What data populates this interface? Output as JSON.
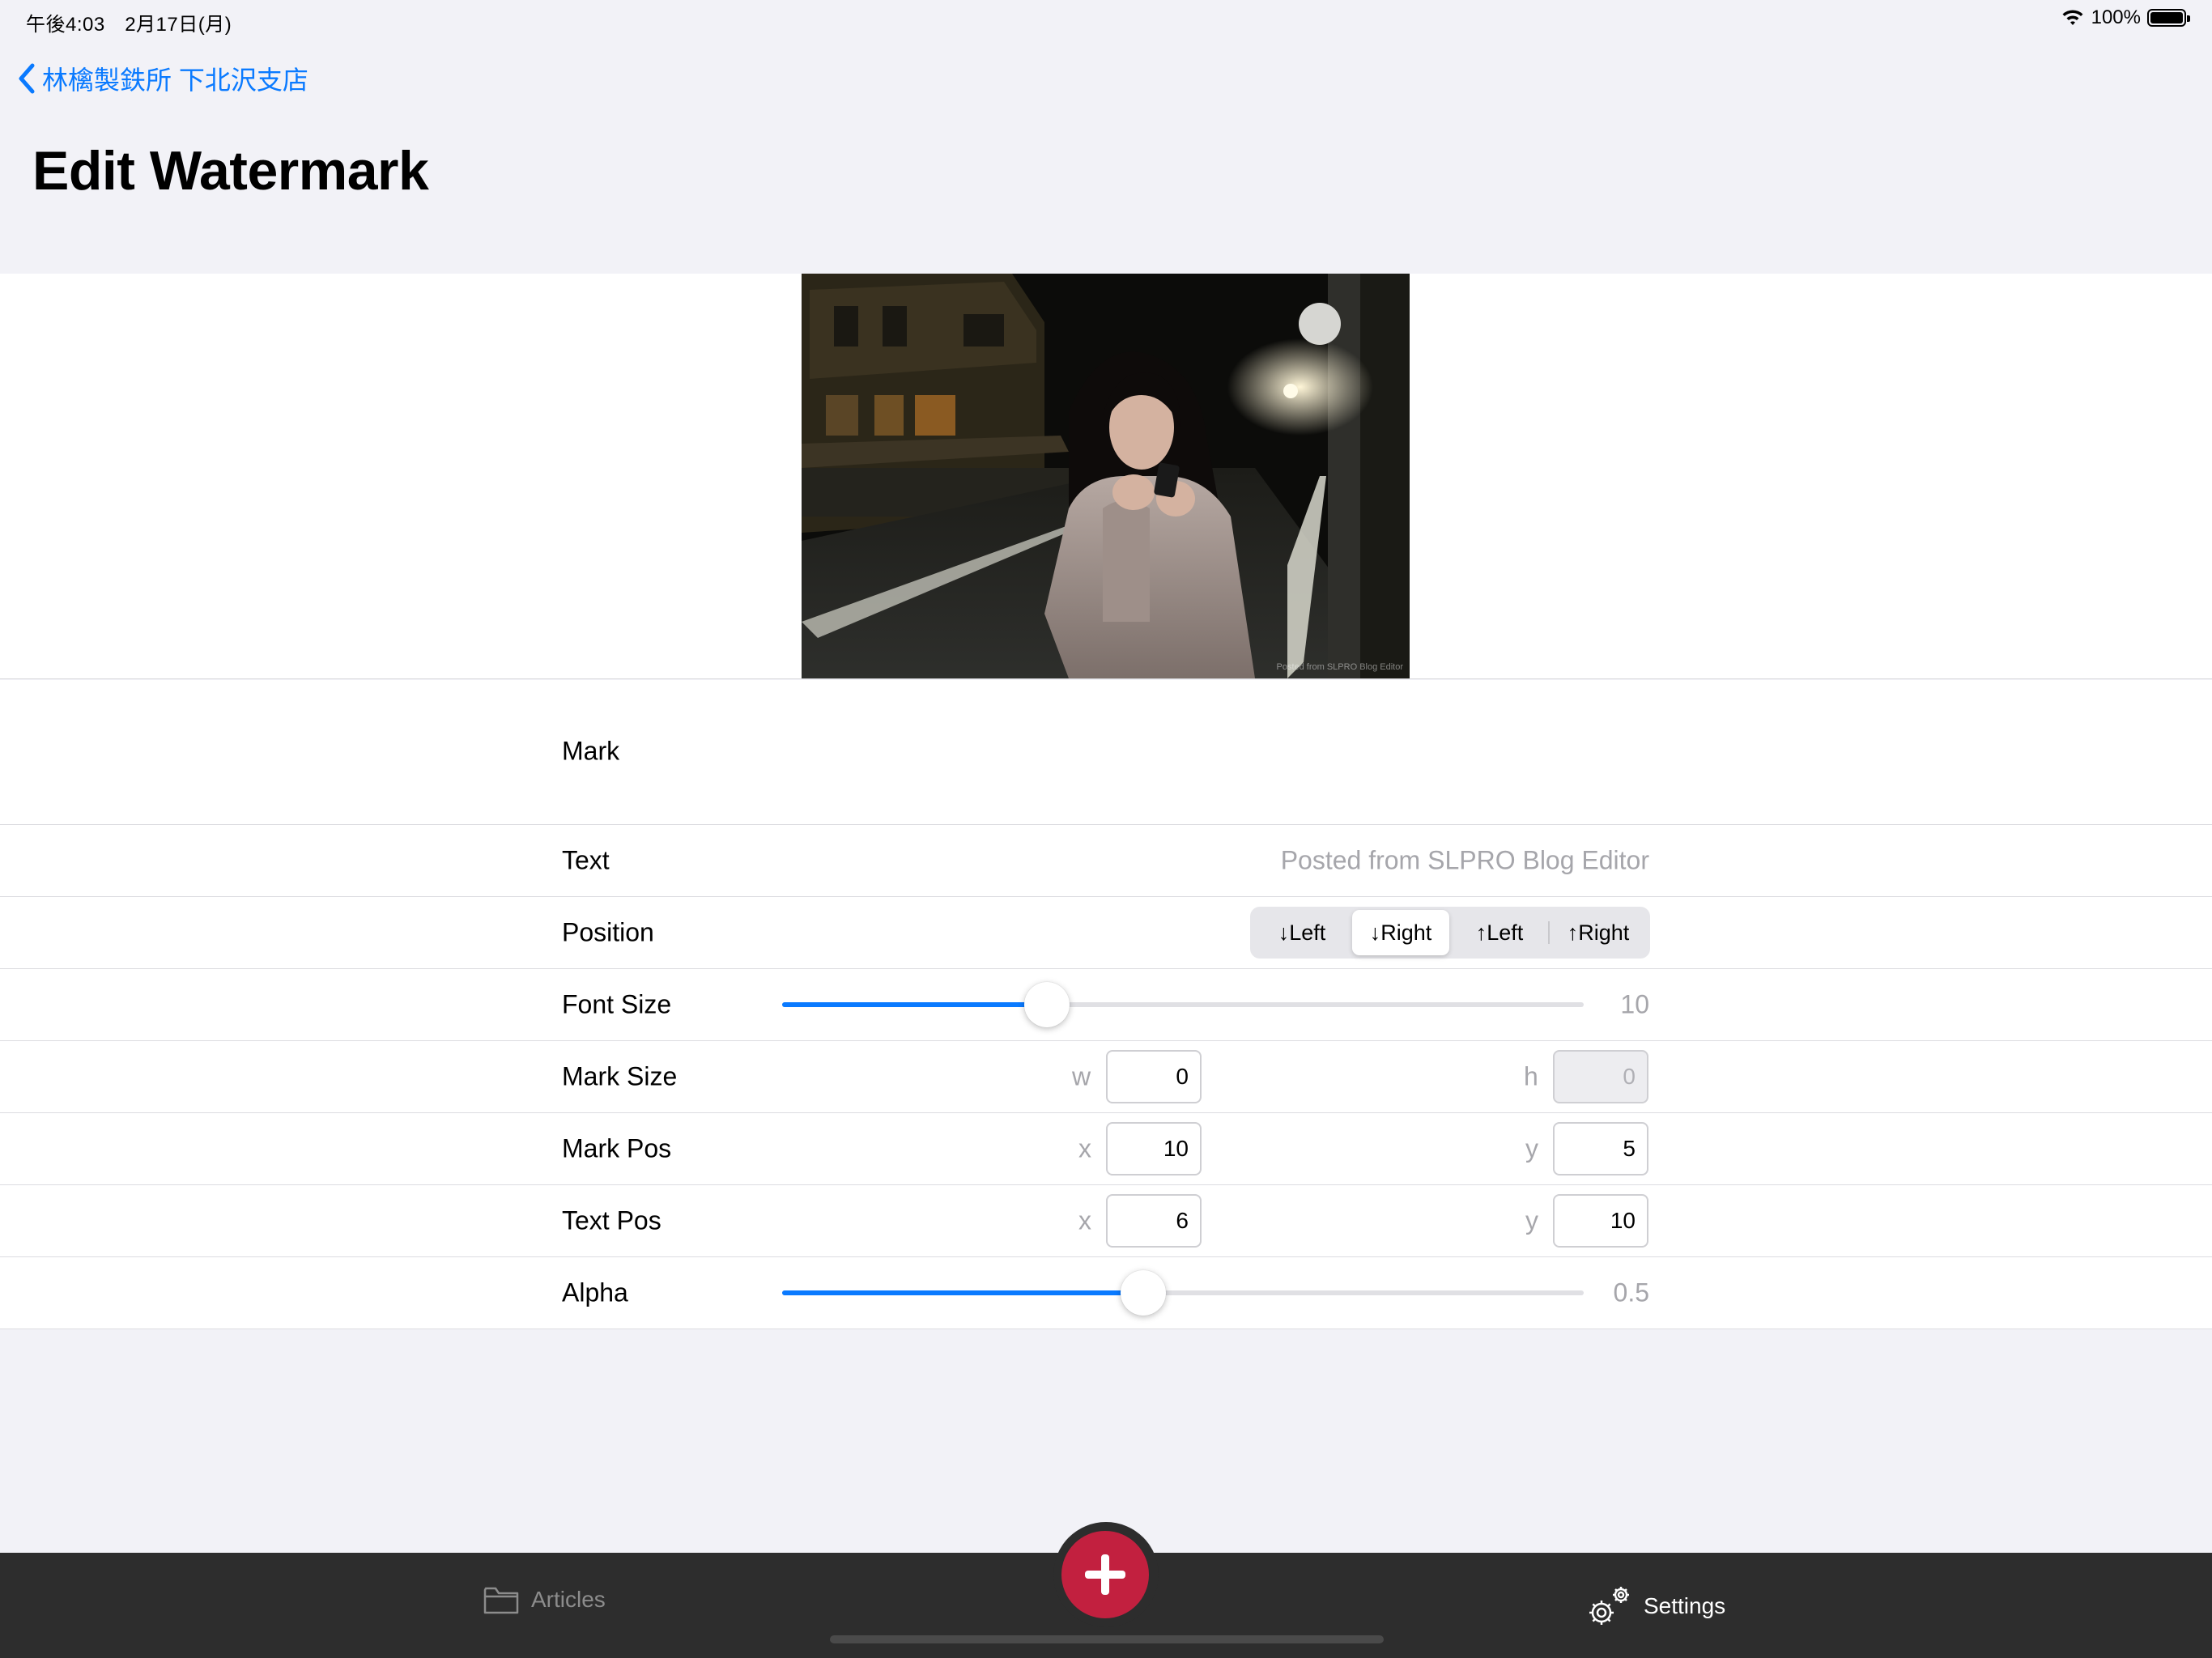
{
  "status_bar": {
    "time": "午後4:03　2月17日(月)",
    "battery": "100%"
  },
  "nav": {
    "back_label": "林檎製鉄所 下北沢支店"
  },
  "page": {
    "title": "Edit Watermark"
  },
  "photo": {
    "watermark_text": "Posted from SLPRO Blog Editor"
  },
  "form": {
    "mark_label": "Mark",
    "text": {
      "label": "Text",
      "value": "Posted from SLPRO Blog Editor"
    },
    "position": {
      "label": "Position",
      "options": [
        "↓Left",
        "↓Right",
        "↑Left",
        "↑Right"
      ],
      "selected": "↓Right"
    },
    "font_size": {
      "label": "Font Size",
      "value": "10",
      "fill_fraction": 0.33
    },
    "mark_size": {
      "label": "Mark Size",
      "w_label": "w",
      "w": "0",
      "h_label": "h",
      "h": "0"
    },
    "mark_pos": {
      "label": "Mark Pos",
      "x_label": "x",
      "x": "10",
      "y_label": "y",
      "y": "5"
    },
    "text_pos": {
      "label": "Text Pos",
      "x_label": "x",
      "x": "6",
      "y_label": "y",
      "y": "10"
    },
    "alpha": {
      "label": "Alpha",
      "value": "0.5",
      "fill_fraction": 0.45
    }
  },
  "tab_bar": {
    "articles_label": "Articles",
    "settings_label": "Settings",
    "fab_icon": "plus-icon"
  },
  "colors": {
    "accent": "#0a7aff",
    "fab": "#c2203f",
    "tab_bar": "#2d2d2d"
  }
}
